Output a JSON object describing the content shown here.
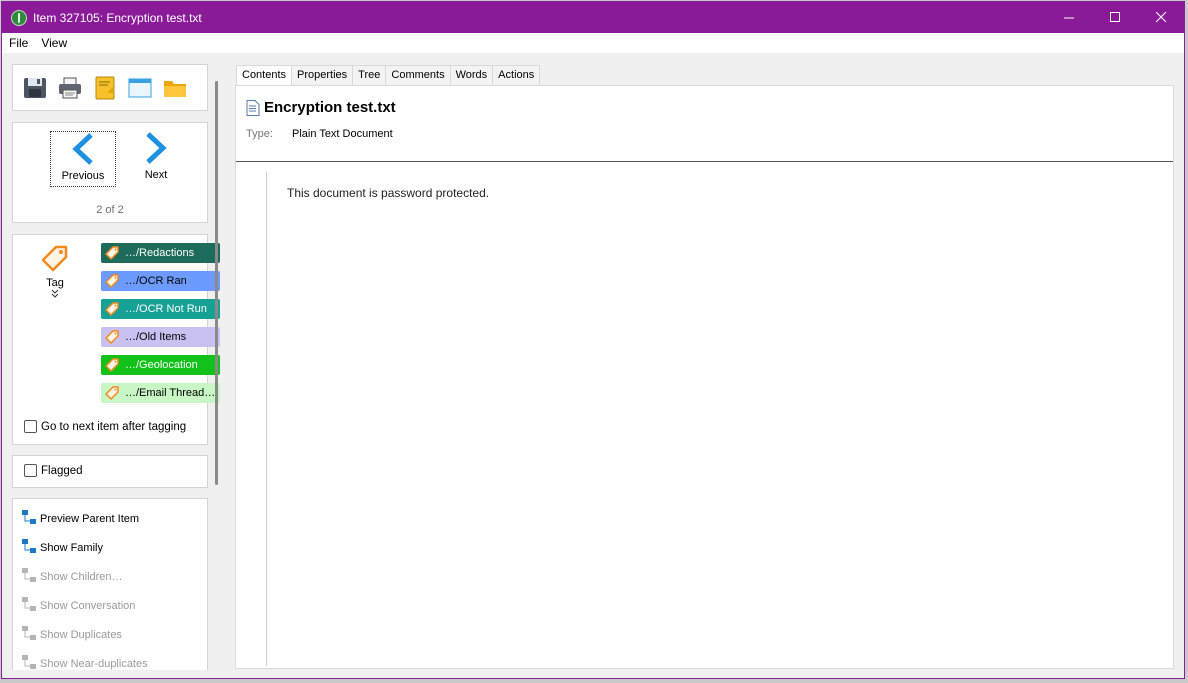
{
  "window": {
    "title": "Item 327105: Encryption test.txt",
    "controls": {
      "minimize": "—",
      "maximize": "☐",
      "close": "✕"
    }
  },
  "menu": {
    "items": [
      "File",
      "View"
    ]
  },
  "toolbar": {
    "icons": [
      "save-icon",
      "print-icon",
      "notes-icon",
      "window-icon",
      "folder-icon"
    ]
  },
  "navigation": {
    "previous_label": "Previous",
    "next_label": "Next",
    "counter": "2 of 2"
  },
  "tagging": {
    "tag_label": "Tag",
    "tags": [
      {
        "label": "…/Redactions",
        "bg": "#1d6b5a",
        "fg": "#ffffff"
      },
      {
        "label": "…/OCR Ran",
        "bg": "#6c9aff",
        "fg": "#000000"
      },
      {
        "label": "…/OCR Not Run",
        "bg": "#15a195",
        "fg": "#ffffff"
      },
      {
        "label": "…/Old Items",
        "bg": "#c9c1f2",
        "fg": "#000000"
      },
      {
        "label": "…/Geolocation",
        "bg": "#12c21a",
        "fg": "#ffffff"
      },
      {
        "label": "…/Email Thread…",
        "bg": "#c9f6c5",
        "fg": "#000000"
      }
    ],
    "next_after_tagging_label": "Go to next item after tagging"
  },
  "flagged": {
    "label": "Flagged"
  },
  "actions": [
    {
      "label": "Preview Parent Item",
      "enabled": true,
      "icon": "parent-item-icon"
    },
    {
      "label": "Show Family",
      "enabled": true,
      "icon": "family-tree-icon"
    },
    {
      "label": "Show Children…",
      "enabled": false,
      "icon": "children-icon"
    },
    {
      "label": "Show Conversation",
      "enabled": false,
      "icon": "conversation-icon"
    },
    {
      "label": "Show Duplicates",
      "enabled": false,
      "icon": "duplicates-icon"
    },
    {
      "label": "Show Near-duplicates",
      "enabled": false,
      "icon": "near-duplicates-icon"
    }
  ],
  "tabs": [
    "Contents",
    "Properties",
    "Tree",
    "Comments",
    "Words",
    "Actions"
  ],
  "active_tab": "Contents",
  "document": {
    "title": "Encryption test.txt",
    "type_label": "Type:",
    "type_value": "Plain Text Document",
    "body": "This document is password protected."
  },
  "colors": {
    "titlebar": "#8b1a99",
    "accent_blue": "#1e90e0"
  }
}
